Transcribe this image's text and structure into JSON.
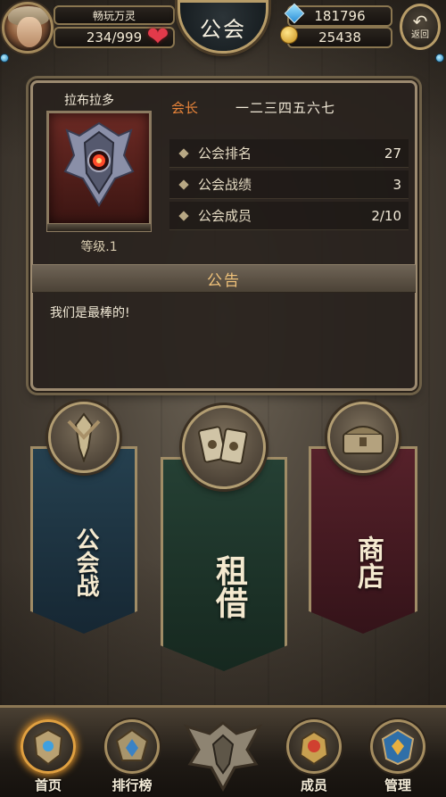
{
  "player": {
    "name": "畅玩万灵",
    "stamina": "234/999",
    "gems": "181796",
    "gold": "25438"
  },
  "header": {
    "title": "公会",
    "back_label": "返回"
  },
  "guild": {
    "name": "拉布拉多",
    "level": "等级.1",
    "leader_label": "会长",
    "leader_name": "一二三四五六七",
    "stats": [
      {
        "label": "公会排名",
        "value": "27"
      },
      {
        "label": "公会战绩",
        "value": "3"
      },
      {
        "label": "公会成员",
        "value": "2/10"
      }
    ],
    "notice_title": "公告",
    "notice_text": "我们是最棒的!"
  },
  "banners": [
    {
      "label": "公会战",
      "icon": "sword-shield-icon",
      "color": "#1e3342"
    },
    {
      "label": "租借",
      "icon": "cards-icon",
      "color": "#1f3328"
    },
    {
      "label": "商店",
      "icon": "treasure-chest-icon",
      "color": "#4a1c22"
    }
  ],
  "nav": [
    {
      "label": "首页",
      "icon": "home-crest-icon",
      "active": true
    },
    {
      "label": "排行榜",
      "icon": "ranking-crest-icon",
      "active": false
    },
    {
      "label": "",
      "icon": "winged-crest-icon",
      "active": false
    },
    {
      "label": "成员",
      "icon": "members-crest-icon",
      "active": false
    },
    {
      "label": "管理",
      "icon": "manage-crest-icon",
      "active": false
    }
  ],
  "colors": {
    "accent_gold": "#b79c68",
    "leader_orange": "#e8843a",
    "notice_title": "#f0c27a",
    "heart": "#e23a4a"
  }
}
